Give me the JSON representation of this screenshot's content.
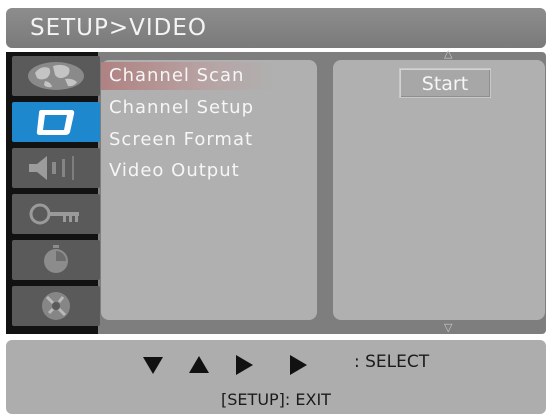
{
  "title": "SETUP>VIDEO",
  "sidebar": {
    "items": [
      {
        "icon": "globe-icon",
        "active": false
      },
      {
        "icon": "monitor-icon",
        "active": true
      },
      {
        "icon": "speaker-icon",
        "active": false
      },
      {
        "icon": "key-icon",
        "active": false
      },
      {
        "icon": "timer-icon",
        "active": false
      },
      {
        "icon": "disc-icon",
        "active": false
      }
    ]
  },
  "menu": {
    "items": [
      {
        "label": "Channel Scan",
        "highlighted": true
      },
      {
        "label": "Channel Setup",
        "highlighted": false
      },
      {
        "label": "Screen Format",
        "highlighted": false
      },
      {
        "label": "Video Output",
        "highlighted": false
      }
    ]
  },
  "option_panel": {
    "start_label": "Start"
  },
  "footer": {
    "nav_keys": [
      "down-arrow-icon",
      "up-arrow-icon",
      "right-arrow-icon",
      "right-arrow-icon"
    ],
    "select_label": ": SELECT",
    "exit_label": "[SETUP]: EXIT"
  },
  "colors": {
    "active_icon_bg": "#1e88ce",
    "highlight": "#b08282",
    "panel_bg": "#b0b0b0"
  }
}
